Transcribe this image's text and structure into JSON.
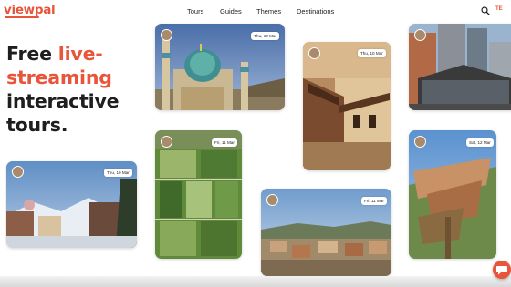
{
  "brand": {
    "logo_text": "viewpal",
    "accent_color": "#e9553a"
  },
  "nav": {
    "items": [
      "Tours",
      "Guides",
      "Themes",
      "Destinations"
    ],
    "search_icon": "search-icon",
    "language": "TE"
  },
  "hero": {
    "line1_plain": "Free ",
    "line1_accent": "live-",
    "line2_accent": "streaming",
    "line3": "interactive",
    "line4": "tours."
  },
  "tours": [
    {
      "id": "mosque",
      "date": "Thu, 10 Mar"
    },
    {
      "id": "desert-house",
      "date": "Thu, 10 Mar"
    },
    {
      "id": "city-tower",
      "date": ""
    },
    {
      "id": "snow-town",
      "date": "Thu, 10 Mar"
    },
    {
      "id": "gardens",
      "date": "Fri, 11 Mar"
    },
    {
      "id": "hill-town",
      "date": "Fri, 11 Mar"
    },
    {
      "id": "palm",
      "date": "Sat, 12 Mar"
    }
  ],
  "chat": {
    "icon": "chat-icon"
  }
}
